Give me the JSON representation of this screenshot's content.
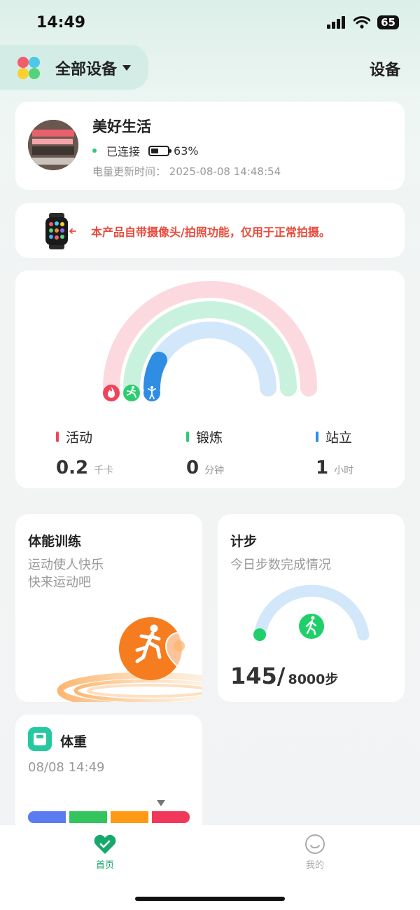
{
  "status_bar": {
    "time": "14:49",
    "battery": "65"
  },
  "header": {
    "device_selector": "全部设备",
    "settings": "设备"
  },
  "device": {
    "name": "美好生活",
    "status": "已连接",
    "battery": "63%",
    "update_label": "电量更新时间：",
    "update_time": "2025-08-08 14:48:54"
  },
  "notice": {
    "text": "本产品自带摄像头/拍照功能，仅用于正常拍摄。"
  },
  "activity": {
    "metrics": [
      {
        "label": "活动",
        "value": "0.2",
        "unit": "千卡",
        "color": "#f0445b"
      },
      {
        "label": "锻炼",
        "value": "0",
        "unit": "分钟",
        "color": "#2ecc71"
      },
      {
        "label": "站立",
        "value": "1",
        "unit": "小时",
        "color": "#2f8de4"
      }
    ],
    "ring_colors": {
      "activity": "#fbd9df",
      "exercise": "#c9f2de",
      "stand": "#d3e7fb",
      "stand_progress": "#2f8de4"
    }
  },
  "fitness": {
    "title": "体能训练",
    "subtitle_line1": "运动使人快乐",
    "subtitle_line2": "快来运动吧"
  },
  "steps": {
    "title": "计步",
    "subtitle": "今日步数完成情况",
    "current": "145/",
    "goal": "8000步",
    "progress": 0.018
  },
  "weight": {
    "title": "体重",
    "time": "08/08 14:49",
    "segment_colors": [
      "#5b7cf0",
      "#33c45e",
      "#ff9a14",
      "#f2385a"
    ]
  },
  "tabbar": {
    "home": "首页",
    "mine": "我的",
    "active_color": "#16a96c"
  }
}
